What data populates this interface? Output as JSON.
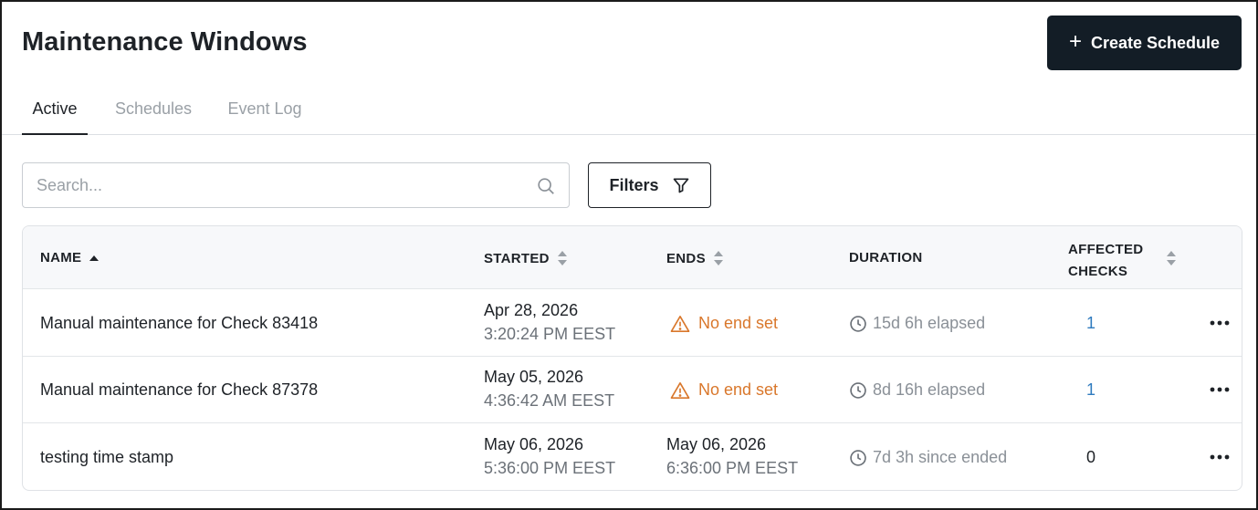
{
  "page": {
    "title": "Maintenance Windows",
    "create_button": "Create Schedule"
  },
  "tabs": [
    {
      "label": "Active",
      "active": true
    },
    {
      "label": "Schedules",
      "active": false
    },
    {
      "label": "Event Log",
      "active": false
    }
  ],
  "toolbar": {
    "search_placeholder": "Search...",
    "filters_label": "Filters"
  },
  "table": {
    "columns": {
      "name": "NAME",
      "started": "STARTED",
      "ends": "ENDS",
      "duration": "DURATION",
      "affected_1": "AFFECTED",
      "affected_2": "CHECKS"
    },
    "rows": [
      {
        "name": "Manual maintenance for Check 83418",
        "started_date": "Apr 28, 2026",
        "started_time": "3:20:24 PM EEST",
        "ends_text": "No end set",
        "duration": "15d 6h elapsed",
        "affected": "1"
      },
      {
        "name": "Manual maintenance for Check 87378",
        "started_date": "May 05, 2026",
        "started_time": "4:36:42 AM EEST",
        "ends_text": "No end set",
        "duration": "8d 16h elapsed",
        "affected": "1"
      },
      {
        "name": "testing time stamp",
        "started_date": "May 06, 2026",
        "started_time": "5:36:00 PM EEST",
        "ends_date": "May 06, 2026",
        "ends_time": "6:36:00 PM EEST",
        "duration": "7d 3h since ended",
        "affected": "0"
      }
    ]
  },
  "colors": {
    "primary_button": "#131d26",
    "warning": "#d9772b",
    "link": "#2f7bbf",
    "muted": "#8a9097"
  },
  "icons": [
    "plus-icon",
    "search-icon",
    "filter-icon",
    "sort-asc-icon",
    "sort-icon",
    "warning-icon",
    "clock-icon",
    "more-icon"
  ]
}
